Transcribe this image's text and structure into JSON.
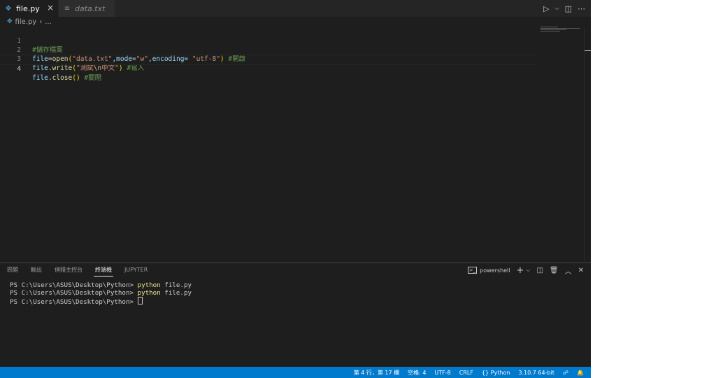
{
  "tabs": [
    {
      "label": "file.py",
      "active": true,
      "icon": "python-file-icon"
    },
    {
      "label": "data.txt",
      "active": false,
      "icon": "text-file-icon"
    }
  ],
  "tab_close_glyph": "×",
  "breadcrumb": {
    "file": "file.py",
    "rest": "..."
  },
  "editor": {
    "lines": [
      {
        "num": "1",
        "comment": "#儲存檔案"
      },
      {
        "num": "2",
        "p1": "file",
        "p2": "=",
        "p3": "open",
        "p4": "(",
        "p5": "\"data.txt\"",
        "p6": ",mode=",
        "p7": "\"w\"",
        "p8": ",encoding= ",
        "p9": "\"utf-8\"",
        "p10": ")",
        "comment": " #開啟"
      },
      {
        "num": "3",
        "p1": "file",
        "p2": ".",
        "p3": "write",
        "p4": "(",
        "p5": "\"測試",
        "p6": "\\n",
        "p7": "中文\"",
        "p8": ")",
        "comment": " #寫入"
      },
      {
        "num": "4",
        "p1": "file",
        "p2": ".",
        "p3": "close",
        "p4": "()",
        "comment": " #關閉"
      }
    ]
  },
  "panel": {
    "tabs": [
      "問題",
      "輸出",
      "偵錯主控台",
      "終端機",
      "JUPYTER"
    ],
    "active_tab": "終端機",
    "shell": "powershell",
    "terminal": [
      {
        "prompt": "PS C:\\Users\\ASUS\\Desktop\\Python> ",
        "cmd": "python",
        "args": " file.py"
      },
      {
        "prompt": "PS C:\\Users\\ASUS\\Desktop\\Python> ",
        "cmd": "python",
        "args": " file.py"
      },
      {
        "prompt": "PS C:\\Users\\ASUS\\Desktop\\Python> ",
        "cmd": "",
        "args": ""
      }
    ]
  },
  "status": {
    "position": "第 4 行，第 17 欄",
    "indent": "空格: 4",
    "encoding": "UTF-8",
    "eol": "CRLF",
    "language": "Python",
    "interpreter": "3.10.7 64-bit"
  },
  "colors": {
    "accent": "#007acc",
    "editor_bg": "#1e1e1e",
    "comment": "#6a9955",
    "string": "#ce9178"
  }
}
